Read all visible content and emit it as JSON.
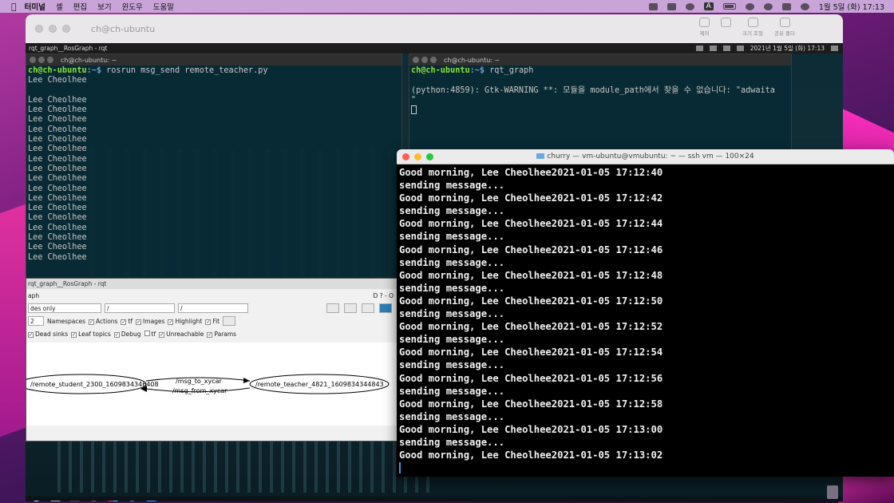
{
  "menubar": {
    "app": "터미널",
    "items": [
      "셸",
      "편집",
      "보기",
      "윈도우",
      "도움말"
    ],
    "ime": "A",
    "clock": "1월 5일 (화)  17:13"
  },
  "vmware": {
    "title": "ch@ch-ubuntu",
    "tools": [
      "제어",
      "",
      "크기 조절",
      "공유 폴더"
    ]
  },
  "ubuntu_bar": {
    "left": "rqt_graph__RosGraph - rqt",
    "clock": "2021년  1월  5일 (화) 17:13"
  },
  "term_left": {
    "title": "ch@ch-ubuntu: ~",
    "prompt_user": "ch@ch-ubuntu",
    "prompt_rest": ":~$ ",
    "command": "rosrun msg_send remote_teacher.py",
    "lines": [
      "Lee Cheolhee",
      "",
      "Lee Cheolhee",
      "Lee Cheolhee",
      "Lee Cheolhee",
      "Lee Cheolhee",
      "Lee Cheolhee",
      "Lee Cheolhee",
      "Lee Cheolhee",
      "Lee Cheolhee",
      "Lee Cheolhee",
      "Lee Cheolhee",
      "Lee Cheolhee",
      "Lee Cheolhee",
      "Lee Cheolhee",
      "Lee Cheolhee",
      "Lee Cheolhee",
      "Lee Cheolhee",
      "Lee Cheolhee"
    ]
  },
  "term_right": {
    "title": "ch@ch-ubuntu: ~",
    "prompt_user": "ch@ch-ubuntu",
    "prompt_rest": ":~$ ",
    "command": "rqt_graph",
    "warning": "(python:4859): Gtk-WARNING **: 모듈을 module_path에서 찾을 수 없습니다: \"adwaita",
    "warning2": "\""
  },
  "rqt": {
    "title": "rqt_graph__RosGraph - rqt",
    "plugin": "aph",
    "plugin_right": "D  ?  -  O",
    "mode": "des only",
    "filter1": "/",
    "filter2": "/",
    "depth": "2",
    "row2": [
      "Namespaces",
      "Actions",
      "tf",
      "Images",
      "Highlight",
      "Fit"
    ],
    "row3": [
      "Dead sinks",
      "Leaf topics",
      "Debug",
      "tf",
      "Unreachable",
      "Params"
    ],
    "node_left": "/remote_student_2300_1609834346408",
    "node_right": "/remote_teacher_4821_1609834344843",
    "edge_top": "/msg_to_xycar",
    "edge_bottom": "/msg_from_xycar"
  },
  "mac_terminal": {
    "title": "churry — vm-ubuntu@vmubuntu: ~ — ssh vm — 100×24",
    "lines": [
      "Good morning, Lee Cheolhee2021-01-05 17:12:40",
      "sending message...",
      "Good morning, Lee Cheolhee2021-01-05 17:12:42",
      "sending message...",
      "Good morning, Lee Cheolhee2021-01-05 17:12:44",
      "sending message...",
      "Good morning, Lee Cheolhee2021-01-05 17:12:46",
      "sending message...",
      "Good morning, Lee Cheolhee2021-01-05 17:12:48",
      "sending message...",
      "Good morning, Lee Cheolhee2021-01-05 17:12:50",
      "sending message...",
      "Good morning, Lee Cheolhee2021-01-05 17:12:52",
      "sending message...",
      "Good morning, Lee Cheolhee2021-01-05 17:12:54",
      "sending message...",
      "Good morning, Lee Cheolhee2021-01-05 17:12:56",
      "sending message...",
      "Good morning, Lee Cheolhee2021-01-05 17:12:58",
      "sending message...",
      "Good morning, Lee Cheolhee2021-01-05 17:13:00",
      "sending message...",
      "Good morning, Lee Cheolhee2021-01-05 17:13:02"
    ]
  },
  "dock_icons": [
    "ubuntu-icon",
    "files-icon",
    "terminal-icon",
    "chrome-icon",
    "slack-icon",
    "settings-icon",
    "vscode-icon"
  ]
}
